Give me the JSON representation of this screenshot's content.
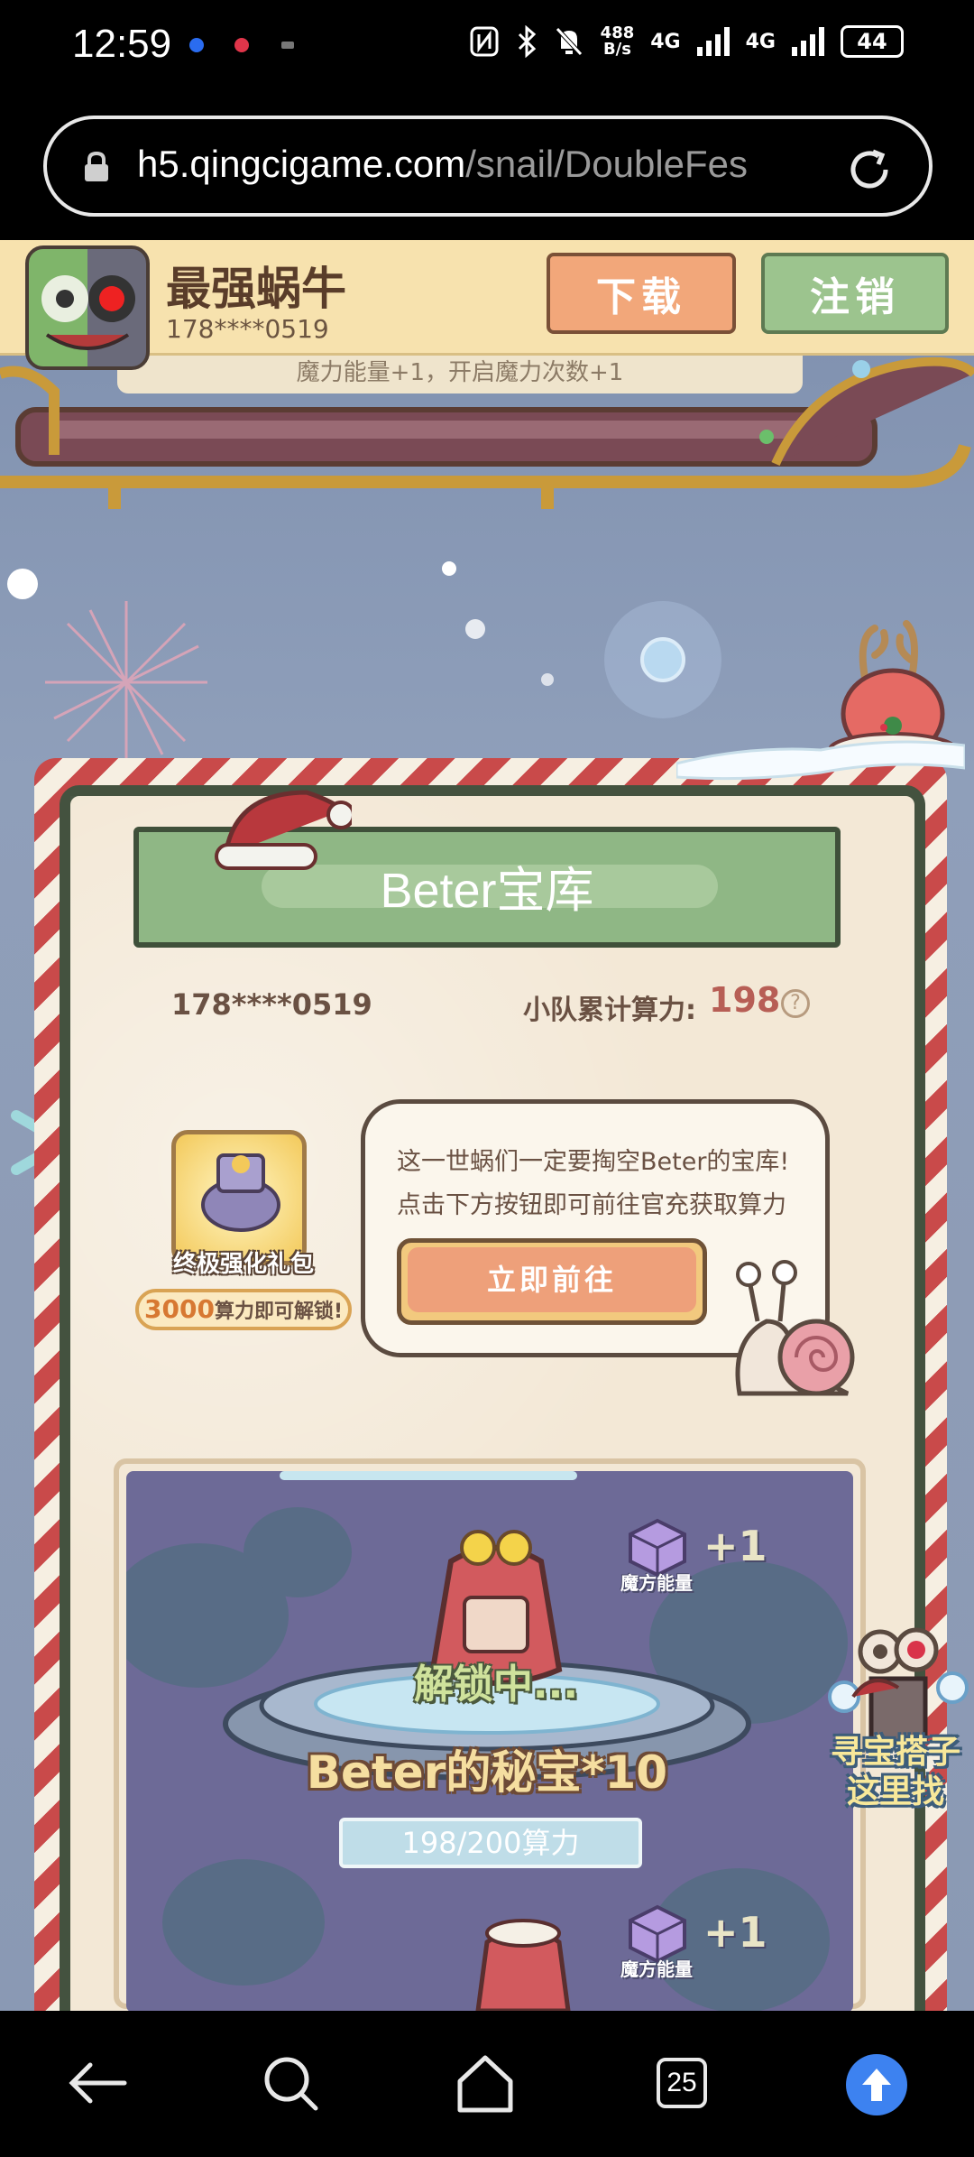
{
  "status_bar": {
    "time": "12:59",
    "net_speed_top": "488",
    "net_speed_bottom": "B/s",
    "net1": "4G",
    "net2": "4G",
    "battery": "44"
  },
  "browser": {
    "url_host": "h5.qingcigame.com",
    "url_path": "/snail/DoubleFes"
  },
  "app_banner": {
    "app_name": "最强蜗牛",
    "user_id": "178****0519",
    "download_label": "下载",
    "logout_label": "注销"
  },
  "sleigh_note": "魔力能量+1，开启魔力次数+1",
  "vault": {
    "title": "Beter宝库",
    "user_id": "178****0519",
    "team_power_label": "小队累计算力:",
    "team_power_value": "198",
    "help_symbol": "?",
    "gift_label": "终极强化礼包",
    "unlock_num": "3000",
    "unlock_suffix": "算力即可解锁!",
    "bubble_line1": "这一世蜗们一定要掏空Beter的宝库!",
    "bubble_line2": "点击下方按钮即可前往官充获取算力",
    "go_button": "立即前往"
  },
  "treasure": {
    "unlocking": "解锁中...",
    "reward_name": "Beter的秘宝*10",
    "progress": "198/200算力",
    "cube_label": "魔方能量",
    "cube_plus": "+1",
    "progress_value": 0.99
  },
  "floating": {
    "line1": "寻宝搭子",
    "line2": "这里找"
  },
  "nav": {
    "tab_count": "25"
  },
  "colors": {
    "accent_red": "#b75e55",
    "download": "#f2a77a",
    "logout": "#9cc48e",
    "go": "#eea07a",
    "browser_up": "#3d82f0"
  }
}
